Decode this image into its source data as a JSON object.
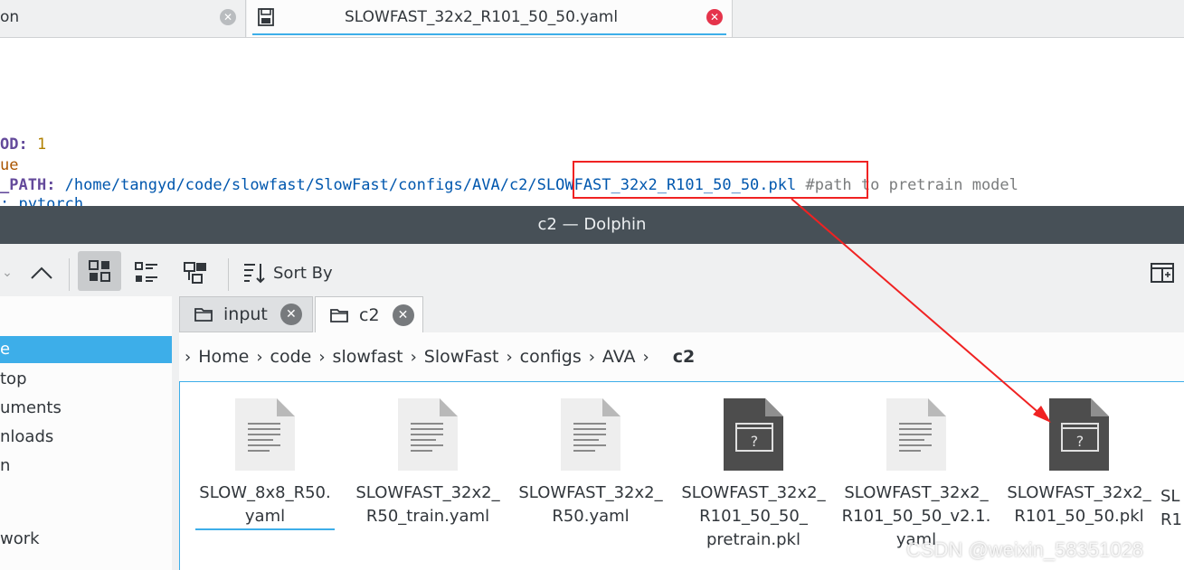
{
  "editor": {
    "tabs": [
      {
        "label": "on"
      },
      {
        "label": "SLOWFAST_32x2_R101_50_50.yaml"
      }
    ],
    "lines": [
      {
        "key": "OD",
        "sep": ": ",
        "value": "1"
      },
      {
        "value": "ue"
      },
      {
        "key": "_PATH",
        "sep": ": ",
        "path": "/home/tangyd/code/slowfast/SlowFast/configs/AVA/c2/SLOWFAST_32x2_R101_50_50.pkl",
        "comment": "#path to pretrain model"
      },
      {
        "value": ": pytorch"
      }
    ]
  },
  "dolphin": {
    "title": "c2 — Dolphin",
    "toolbar": {
      "sort_label": "Sort By"
    },
    "sidebar": [
      "e",
      "top",
      "uments",
      "nloads",
      "n",
      "",
      "",
      "work"
    ],
    "tabs": [
      {
        "label": "input"
      },
      {
        "label": "c2"
      }
    ],
    "breadcrumb": [
      "Home",
      "code",
      "slowfast",
      "SlowFast",
      "configs",
      "AVA",
      "c2"
    ],
    "files": [
      {
        "name": "SLOW_8x8_R50.\nyaml",
        "kind": "text"
      },
      {
        "name": "SLOWFAST_32x2_\nR50_train.yaml",
        "kind": "text"
      },
      {
        "name": "SLOWFAST_32x2_\nR50.yaml",
        "kind": "text"
      },
      {
        "name": "SLOWFAST_32x2_\nR101_50_50_\npretrain.pkl",
        "kind": "unknown"
      },
      {
        "name": "SLOWFAST_32x2_\nR101_50_50_v2.1.\nyaml",
        "kind": "text"
      },
      {
        "name": "SLOWFAST_32x2_\nR101_50_50.pkl",
        "kind": "unknown"
      },
      {
        "name": "SL\nR1",
        "kind": "text"
      }
    ]
  },
  "watermark": "CSDN @weixin_58351028",
  "colors": {
    "accent": "#3daee9",
    "annotation": "#f02222",
    "titlebar": "#475057"
  }
}
